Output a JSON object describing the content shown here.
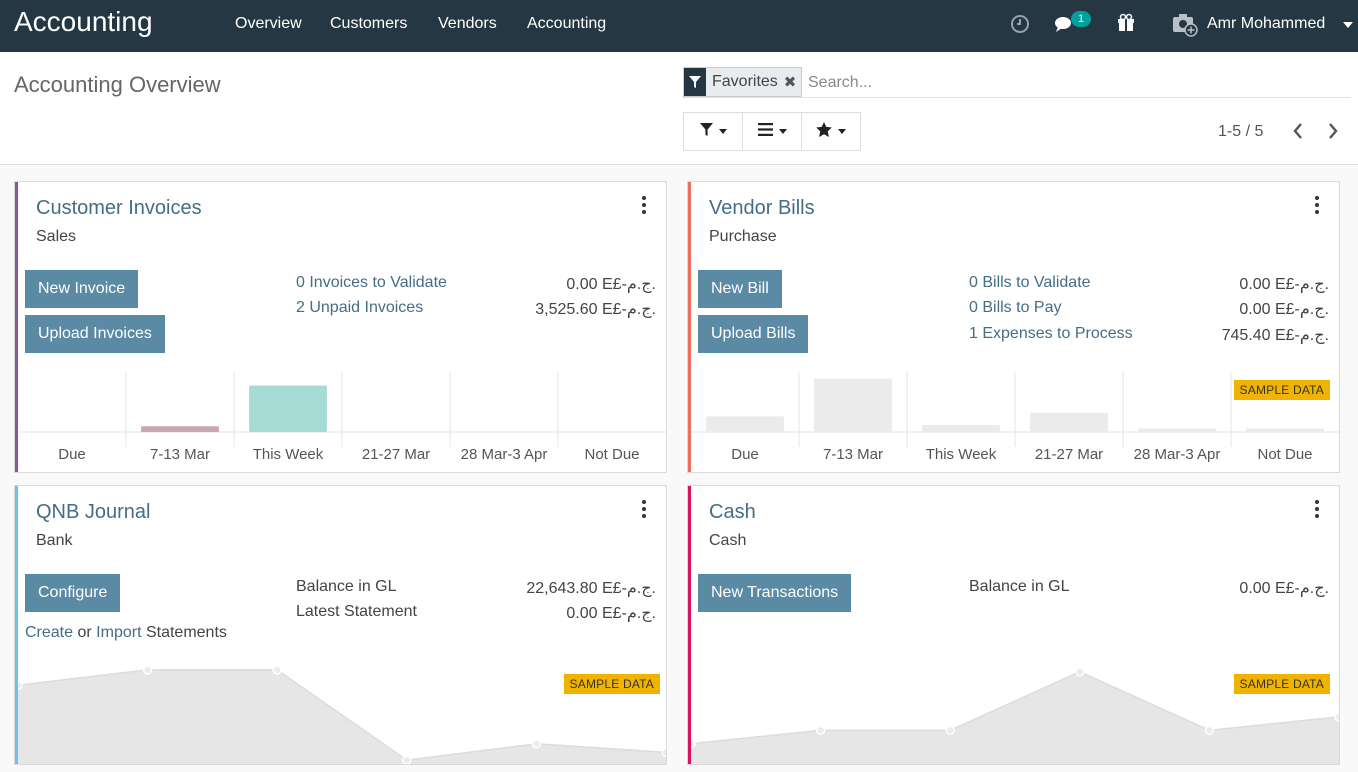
{
  "app": {
    "brand": "Accounting",
    "menu": [
      "Overview",
      "Customers",
      "Vendors",
      "Accounting"
    ],
    "notification_count": "1",
    "user_name": "Amr Mohammed"
  },
  "control_panel": {
    "title": "Accounting Overview",
    "search_facet": "Favorites",
    "search_placeholder": "Search...",
    "pager": "1-5 / 5"
  },
  "cards": {
    "customer_invoices": {
      "title": "Customer Invoices",
      "subtitle": "Sales",
      "buttons": [
        "New Invoice",
        "Upload Invoices"
      ],
      "stats": [
        {
          "label": "0 Invoices to Validate",
          "amount": "0.00 E£-ج.م."
        },
        {
          "label": "2 Unpaid Invoices",
          "amount": "3,525.60 E£-ج.م."
        }
      ],
      "accent_color": "#875a9b"
    },
    "vendor_bills": {
      "title": "Vendor Bills",
      "subtitle": "Purchase",
      "buttons": [
        "New Bill",
        "Upload Bills"
      ],
      "stats": [
        {
          "label": "0 Bills to Validate",
          "amount": "0.00 E£-ج.م."
        },
        {
          "label": "0 Bills to Pay",
          "amount": "0.00 E£-ج.م."
        },
        {
          "label": "1 Expenses to Process",
          "amount": "745.40 E£-ج.م."
        }
      ],
      "sample_badge": "SAMPLE DATA",
      "accent_color": "#ef6f5e"
    },
    "qnb_journal": {
      "title": "QNB Journal",
      "subtitle": "Bank",
      "button": "Configure",
      "links": {
        "create": "Create",
        "or": "or",
        "import": "Import",
        "statements": "Statements"
      },
      "stats": [
        {
          "label": "Balance in GL",
          "amount": "22,643.80 E£-ج.م."
        },
        {
          "label": "Latest Statement",
          "amount": "0.00 E£-ج.م."
        }
      ],
      "sample_badge": "SAMPLE DATA",
      "accent_color": "#6cc1ed"
    },
    "cash": {
      "title": "Cash",
      "subtitle": "Cash",
      "button": "New Transactions",
      "stats": [
        {
          "label": "Balance in GL",
          "amount": "0.00 E£-ج.م."
        }
      ],
      "sample_badge": "SAMPLE DATA",
      "accent_color": "#d6145f"
    }
  },
  "chart_data": [
    {
      "type": "bar",
      "categories": [
        "Due",
        "7-13 Mar",
        "This Week",
        "21-27 Mar",
        "28 Mar-3 Apr",
        "Not Due"
      ],
      "values": [
        0,
        0.1,
        0.8,
        0,
        0,
        0
      ],
      "colors": [
        "#e0e0e0",
        "#c9a8b4",
        "#a5dad5",
        "#e0e0e0",
        "#e0e0e0",
        "#e0e0e0"
      ]
    },
    {
      "type": "bar",
      "categories": [
        "Due",
        "7-13 Mar",
        "This Week",
        "21-27 Mar",
        "28 Mar-3 Apr",
        "Not Due"
      ],
      "values": [
        0.27,
        0.92,
        0.12,
        0.33,
        0.06,
        0.06
      ],
      "colors": [
        "#ebebeb",
        "#ebebeb",
        "#ebebeb",
        "#ebebeb",
        "#ebebeb",
        "#ebebeb"
      ]
    },
    {
      "type": "area",
      "x": [
        0,
        1,
        2,
        3,
        4,
        5
      ],
      "values": [
        0.8,
        0.96,
        0.96,
        0.02,
        0.19,
        0.1
      ],
      "color": "#e6e6e6"
    },
    {
      "type": "area",
      "x": [
        0,
        1,
        2,
        3,
        4,
        5
      ],
      "values": [
        0.19,
        0.33,
        0.33,
        0.94,
        0.33,
        0.47
      ],
      "color": "#e6e6e6"
    }
  ]
}
